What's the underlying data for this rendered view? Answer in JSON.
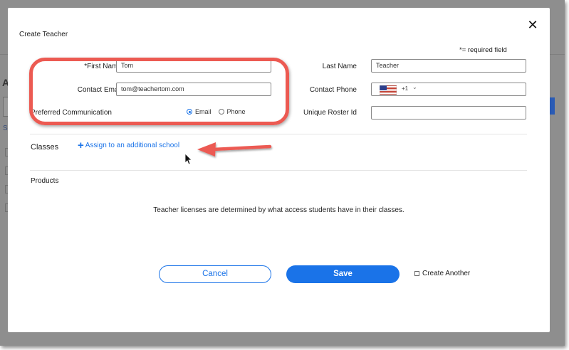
{
  "modal": {
    "title": "Create Teacher",
    "required_note": "*= required field"
  },
  "form": {
    "first_name": {
      "label": "*First Name",
      "value": "Tom"
    },
    "contact_email": {
      "label": "Contact Email",
      "value": "tom@teachertom.com"
    },
    "preferred_communication": {
      "label": "Preferred Communication",
      "options": [
        "Email",
        "Phone"
      ],
      "selected": "Email"
    },
    "last_name": {
      "label": "Last Name",
      "value": "Teacher"
    },
    "contact_phone": {
      "label": "Contact Phone",
      "country_code": "+1",
      "value": ""
    },
    "unique_roster_id": {
      "label": "Unique Roster Id",
      "value": ""
    }
  },
  "classes": {
    "label": "Classes",
    "assign_link": "Assign to an additional school"
  },
  "products": {
    "label": "Products",
    "info": "Teacher licenses are determined by what access students have in their classes."
  },
  "actions": {
    "cancel": "Cancel",
    "save": "Save",
    "create_another": "Create Another"
  },
  "colors": {
    "accent": "#1a73e8",
    "annotation": "#ec5a52"
  }
}
